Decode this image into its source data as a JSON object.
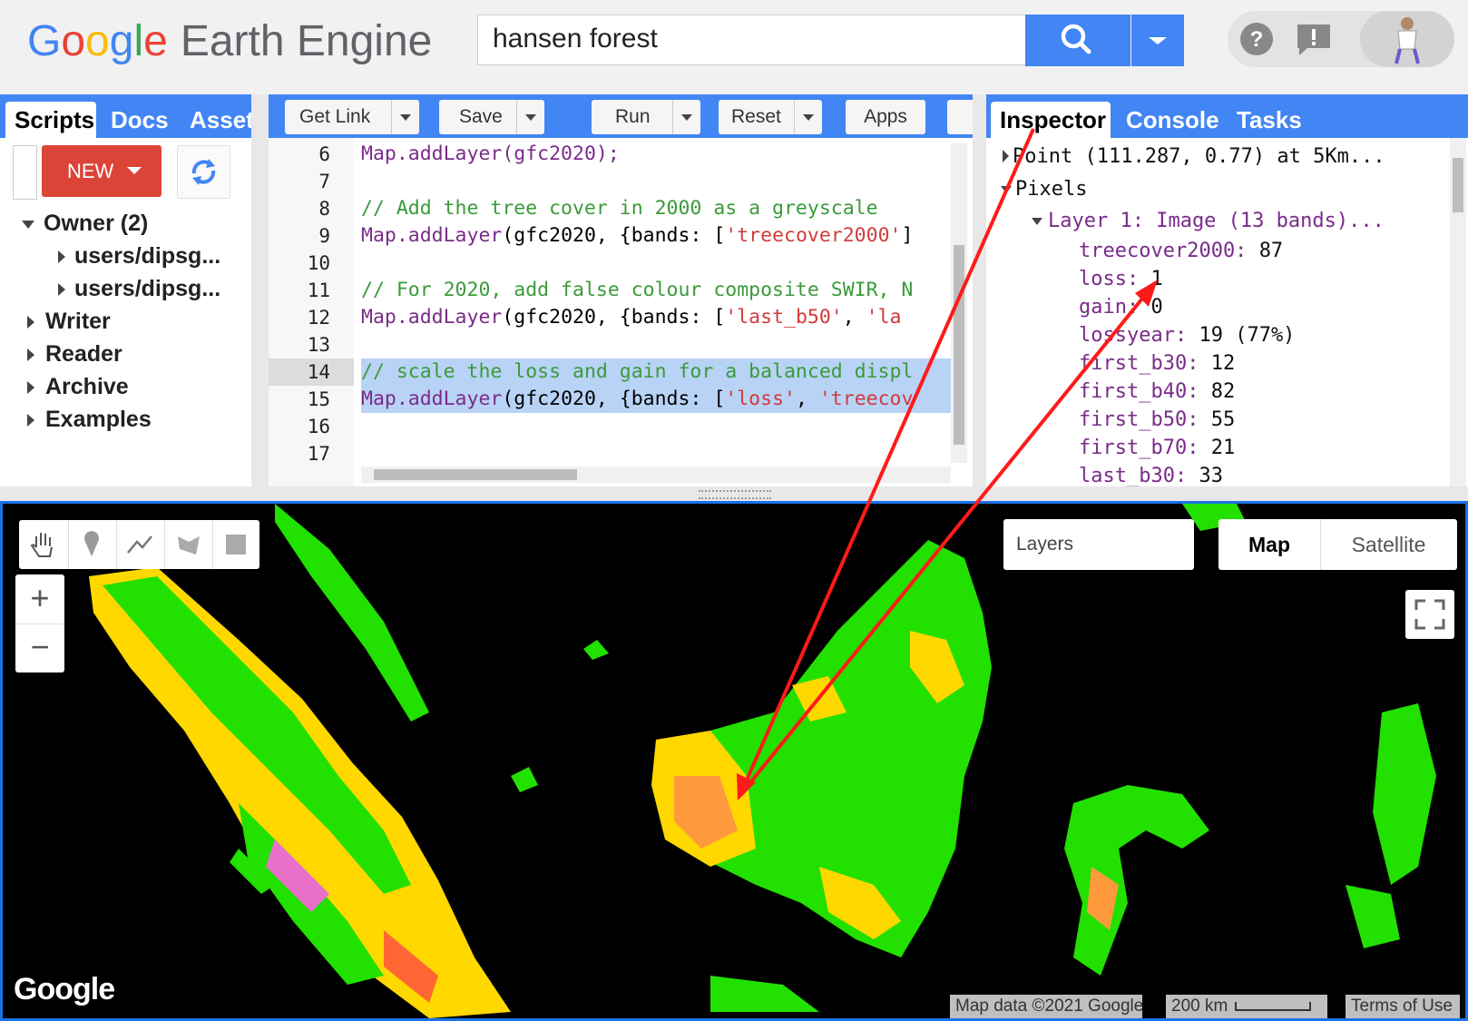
{
  "header": {
    "logo_letters": [
      "G",
      "o",
      "o",
      "g",
      "l",
      "e"
    ],
    "product_name": "Earth Engine",
    "search_value": "hansen forest",
    "icons": [
      "search-icon",
      "chevron-down-icon",
      "help-icon",
      "feedback-icon",
      "avatar"
    ]
  },
  "left_panel": {
    "tabs": [
      "Scripts",
      "Docs",
      "Asset"
    ],
    "new_button": "NEW",
    "tree": [
      {
        "label": "Owner (2)",
        "expanded": true
      },
      {
        "label": "users/dipsg...",
        "child": true
      },
      {
        "label": "users/dipsg...",
        "child": true
      },
      {
        "label": "Writer"
      },
      {
        "label": "Reader"
      },
      {
        "label": "Archive"
      },
      {
        "label": "Examples"
      }
    ]
  },
  "editor": {
    "toolbar": [
      "Get Link",
      "Save",
      "Run",
      "Reset",
      "Apps"
    ],
    "line_numbers": [
      "6",
      "7",
      "8",
      "9",
      "10",
      "11",
      "12",
      "13",
      "14",
      "15",
      "16",
      "17"
    ],
    "lines": {
      "l6": "Map.addLayer(gfc2020);",
      "l8": "// Add the tree cover in 2000 as a greyscale",
      "l9a": "Map.addLayer",
      "l9b": "(gfc2020, {bands: [",
      "l9c": "'treecover2000'",
      "l9d": "]",
      "l11": "// For 2020, add false colour composite SWIR, N",
      "l12a": "Map.addLayer",
      "l12b": "(gfc2020, {bands: [",
      "l12c": "'last_b50'",
      "l12d": ", ",
      "l12e": "'la",
      "l14": "// scale the loss and gain for a balanced displ",
      "l15a": "Map.addLayer",
      "l15b": "(gfc2020, {bands: [",
      "l15c": "'loss'",
      "l15d": ", ",
      "l15e": "'treecov"
    }
  },
  "right_panel": {
    "tabs": [
      "Inspector",
      "Console",
      "Tasks"
    ],
    "point": "Point (111.287, 0.77) at 5Km...",
    "pixels": "Pixels",
    "layer": "Layer 1: Image (13 bands)...",
    "props": [
      {
        "k": "treecover2000:",
        "v": "87"
      },
      {
        "k": "loss:",
        "v": "1"
      },
      {
        "k": "gain:",
        "v": "0"
      },
      {
        "k": "lossyear:",
        "v": "19 (77%)"
      },
      {
        "k": "first_b30:",
        "v": "12"
      },
      {
        "k": "first_b40:",
        "v": "82"
      },
      {
        "k": "first_b50:",
        "v": "55"
      },
      {
        "k": "first_b70:",
        "v": "21"
      },
      {
        "k": "last_b30:",
        "v": "33"
      }
    ]
  },
  "map": {
    "layers_label": "Layers",
    "map_type_buttons": [
      "Map",
      "Satellite"
    ],
    "zoom_in": "+",
    "zoom_out": "−",
    "google_logo": "Google",
    "attribution": "Map data ©2021 Google",
    "scale_text": "200 km",
    "terms": "Terms of Use",
    "draw_tools": [
      "hand-icon",
      "marker-icon",
      "line-icon",
      "polygon-icon",
      "rectangle-icon"
    ]
  },
  "colors": {
    "accent": "#4285f4",
    "new_button": "#db4437",
    "annotation_arrow": "#ff1a1a",
    "forest_green": "#22dd00",
    "loss_yellow": "#ffe100"
  }
}
